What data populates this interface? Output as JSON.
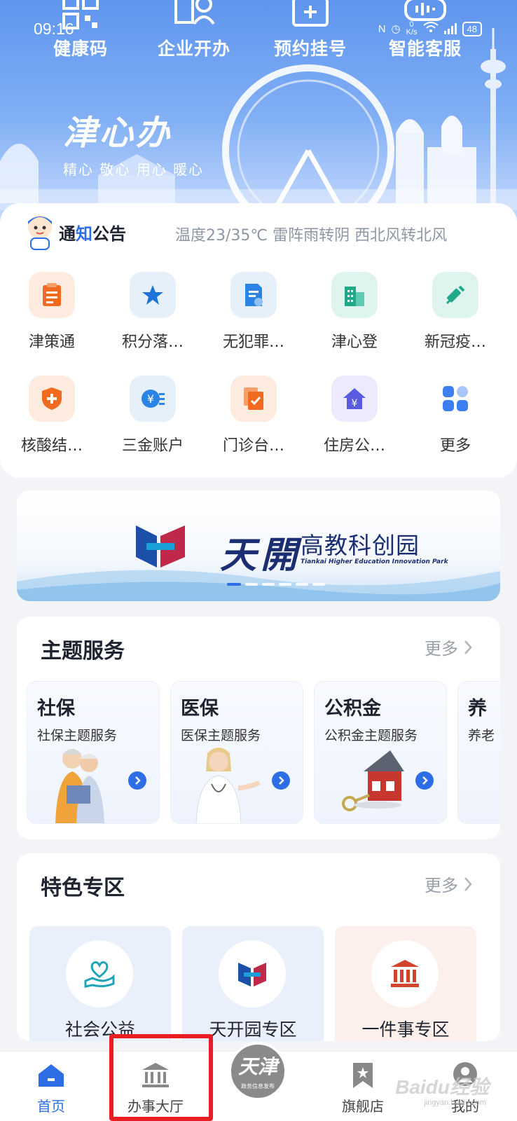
{
  "status_bar": {
    "time": "09:16",
    "network_speed_value": "0",
    "network_speed_unit": "K/s",
    "signal": "5G",
    "battery": "48"
  },
  "quick_actions": [
    {
      "label": "健康码",
      "icon": "qr-code-icon"
    },
    {
      "label": "企业开办",
      "icon": "enterprise-icon"
    },
    {
      "label": "预约挂号",
      "icon": "medical-kit-icon"
    },
    {
      "label": "智能客服",
      "icon": "voice-wave-icon"
    }
  ],
  "brand": {
    "name": "津心办",
    "slogan": "精心 敬心 用心 暖心"
  },
  "notice": {
    "title_part1": "通",
    "title_part2": "知",
    "title_part3": "公告",
    "text": "温度23/35℃ 雷阵雨转阴 西北风转北风"
  },
  "services": [
    {
      "label": "津策通",
      "icon": "clipboard-icon",
      "bg": "#fdebe0",
      "color": "#f06a1f"
    },
    {
      "label": "积分落…",
      "icon": "star-icon",
      "bg": "#e5f0fb",
      "color": "#1e73d8"
    },
    {
      "label": "无犯罪…",
      "icon": "certificate-icon",
      "bg": "#e5f0fb",
      "color": "#2b84e6"
    },
    {
      "label": "津心登",
      "icon": "building-icon",
      "bg": "#dff4ef",
      "color": "#1fa88a"
    },
    {
      "label": "新冠疫…",
      "icon": "syringe-icon",
      "bg": "#dff4ef",
      "color": "#1fa88a"
    },
    {
      "label": "核酸结…",
      "icon": "shield-plus-icon",
      "bg": "#fdebe0",
      "color": "#f06a1f"
    },
    {
      "label": "三金账户",
      "icon": "yen-coin-icon",
      "bg": "#e5f0fb",
      "color": "#2b84e6"
    },
    {
      "label": "门诊台…",
      "icon": "document-check-icon",
      "bg": "#fdebe0",
      "color": "#f06a1f"
    },
    {
      "label": "住房公…",
      "icon": "house-yen-icon",
      "bg": "#eceafc",
      "color": "#5b5be0"
    },
    {
      "label": "更多",
      "icon": "grid-more-icon",
      "bg": "#ffffff",
      "color": "#3d7ef0"
    }
  ],
  "banner": {
    "brand_text": "天開",
    "title": "高教科创园",
    "subtitle": "Tiankai Higher Education Innovation Park",
    "slides": 6,
    "active_slide": 1
  },
  "theme_services": {
    "title": "主题服务",
    "more": "更多",
    "cards": [
      {
        "title": "社保",
        "subtitle": "社保主题服务"
      },
      {
        "title": "医保",
        "subtitle": "医保主题服务"
      },
      {
        "title": "公积金",
        "subtitle": "公积金主题服务"
      },
      {
        "title": "养",
        "subtitle": "养老"
      }
    ]
  },
  "special_zone": {
    "title": "特色专区",
    "more": "更多",
    "items": [
      {
        "label": "社会公益",
        "icon": "heart-hand-icon",
        "bg": "#e9f0fc"
      },
      {
        "label": "天开园专区",
        "icon": "tiankai-logo-icon",
        "bg": "#e9f0fc"
      },
      {
        "label": "一件事专区",
        "icon": "government-building-icon",
        "bg": "#fdf0ec"
      }
    ]
  },
  "tabbar": {
    "tabs": [
      {
        "label": "首页",
        "icon": "home-icon",
        "active": true
      },
      {
        "label": "办事大厅",
        "icon": "hall-icon",
        "active": false
      },
      {
        "label": "旗舰店",
        "icon": "bookmark-star-icon",
        "active": false
      },
      {
        "label": "我的",
        "icon": "user-icon",
        "active": false
      }
    ],
    "center": {
      "main": "天津",
      "sub": "政务信息发布"
    }
  },
  "watermark": {
    "brand": "Baidu经验",
    "url": "jingyan.baidu.com"
  },
  "colors": {
    "accent": "#2d6ee6",
    "highlight": "#ea1c24",
    "hero_top": "#5f95ee"
  }
}
